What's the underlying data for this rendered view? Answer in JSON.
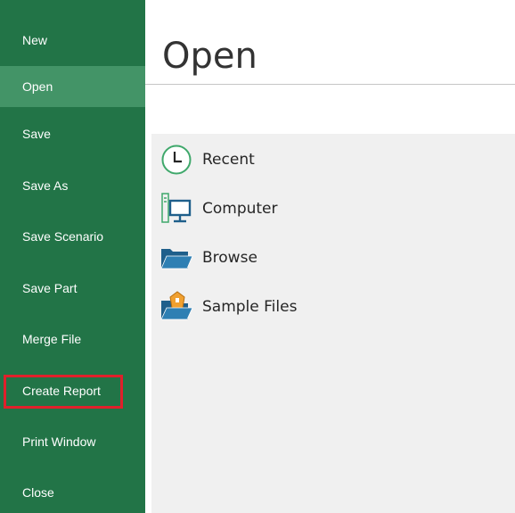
{
  "sidebar": {
    "items": [
      {
        "label": "New"
      },
      {
        "label": "Open"
      },
      {
        "label": "Save"
      },
      {
        "label": "Save As"
      },
      {
        "label": "Save Scenario"
      },
      {
        "label": "Save Part"
      },
      {
        "label": "Merge File"
      },
      {
        "label": "Create Report"
      },
      {
        "label": "Print Window"
      },
      {
        "label": "Close"
      }
    ],
    "active_item": "Open",
    "highlighted_item": "Create Report"
  },
  "main": {
    "title": "Open",
    "locations": [
      {
        "label": "Recent",
        "icon": "clock-icon"
      },
      {
        "label": "Computer",
        "icon": "computer-icon"
      },
      {
        "label": "Browse",
        "icon": "folder-icon"
      },
      {
        "label": "Sample Files",
        "icon": "sample-folder-icon"
      }
    ]
  },
  "colors": {
    "sidebar_bg": "#227447",
    "sidebar_active": "#439467",
    "highlight_border": "#e0202b",
    "panel_bg": "#f0f0f0",
    "icon_green": "#3fa86b",
    "icon_blue": "#1f5f8b"
  }
}
